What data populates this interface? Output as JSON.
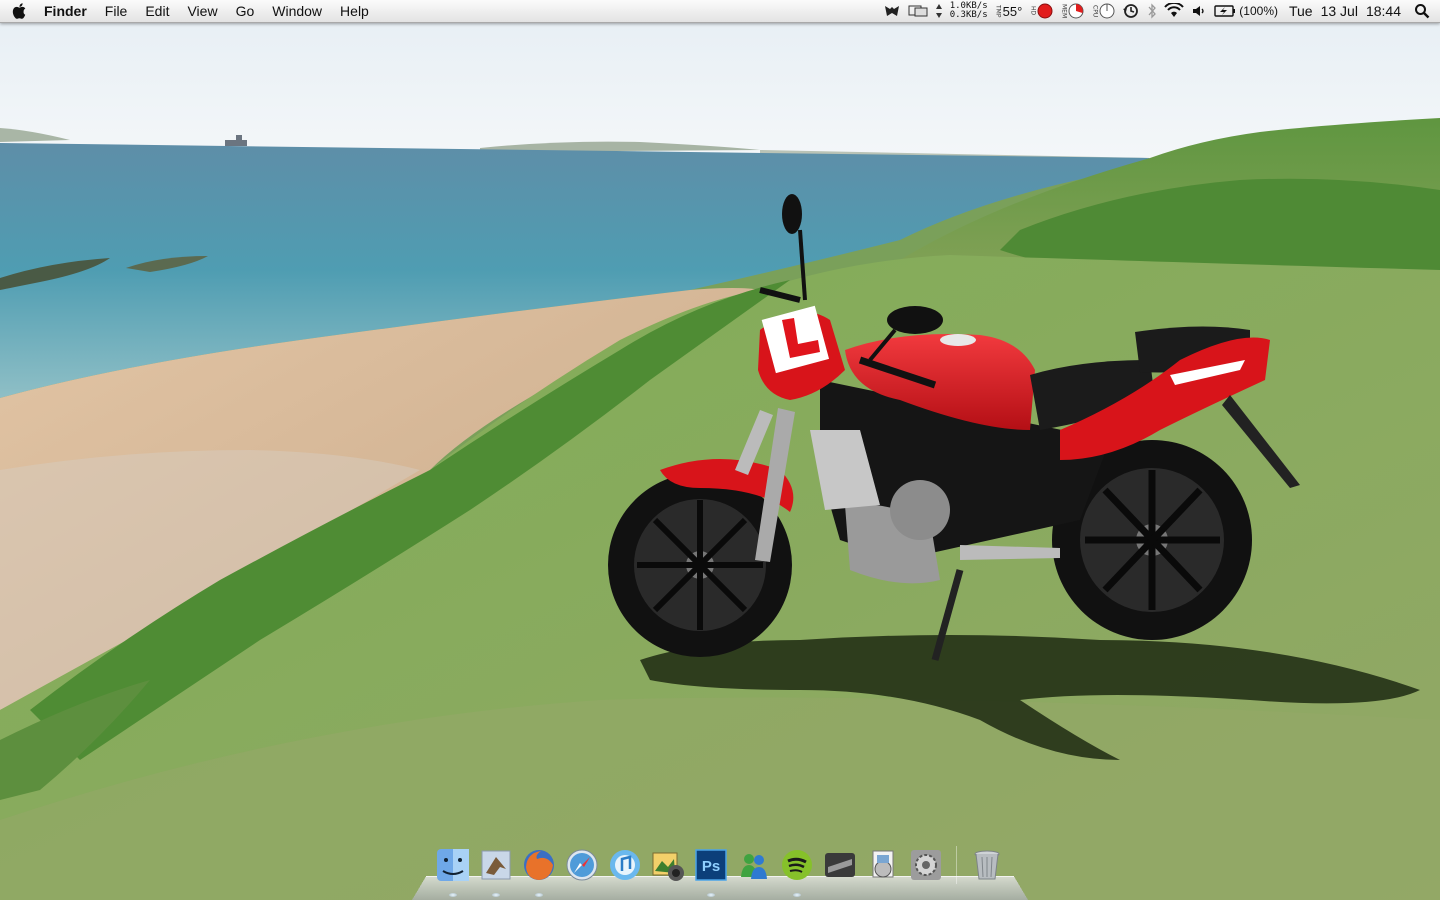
{
  "menubar": {
    "app_name": "Finder",
    "menus": [
      "File",
      "Edit",
      "View",
      "Go",
      "Window",
      "Help"
    ],
    "net_up": "1.0KB/s",
    "net_down": "0.3KB/s",
    "temp_label": "TMP",
    "temperature": "55°",
    "hdd_label": "HD",
    "mem_label": "MEM",
    "cpu_label": "CPU",
    "battery_percent": "(100%)",
    "day": "Tue",
    "date": "13 Jul",
    "time": "18:44"
  },
  "dock": {
    "apps": [
      {
        "name": "Finder",
        "icon": "finder-icon"
      },
      {
        "name": "Mail",
        "icon": "mail-icon"
      },
      {
        "name": "Firefox",
        "icon": "firefox-icon"
      },
      {
        "name": "Safari",
        "icon": "safari-icon"
      },
      {
        "name": "iTunes",
        "icon": "itunes-icon"
      },
      {
        "name": "iPhoto",
        "icon": "iphoto-icon"
      },
      {
        "name": "Photoshop",
        "icon": "photoshop-icon",
        "label": "Ps"
      },
      {
        "name": "Messenger",
        "icon": "messenger-icon"
      },
      {
        "name": "Spotify",
        "icon": "spotify-icon"
      },
      {
        "name": "Steam",
        "icon": "steam-icon"
      },
      {
        "name": "Preview",
        "icon": "preview-icon"
      },
      {
        "name": "System Preferences",
        "icon": "system-preferences-icon"
      }
    ],
    "trash": {
      "name": "Trash",
      "icon": "trash-icon"
    }
  },
  "colors": {
    "sky": "#eef3f7",
    "sea": "#4f9bb2",
    "sand": "#d9b896",
    "grass": "#7aa258",
    "bike_red": "#d8141a"
  }
}
